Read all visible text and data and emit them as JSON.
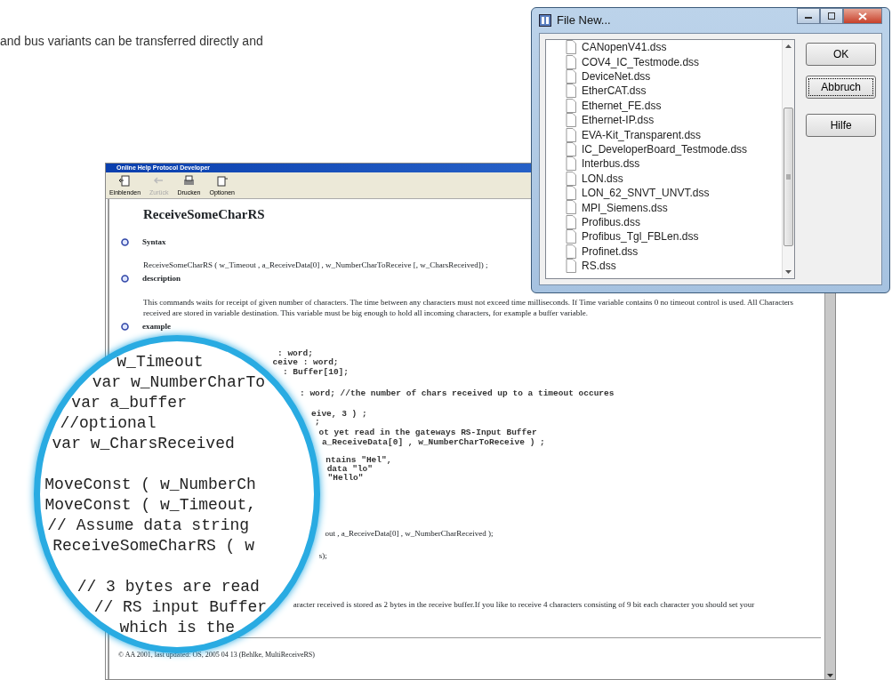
{
  "page_text": "and bus variants can be transferred directly and",
  "help_window": {
    "title": "Online Help Protocol Developer",
    "toolbar": [
      {
        "label": "Einblenden",
        "disabled": false,
        "kind": "show"
      },
      {
        "label": "Zurück",
        "disabled": true,
        "kind": "back"
      },
      {
        "label": "Drucken",
        "disabled": false,
        "kind": "print"
      },
      {
        "label": "Optionen",
        "disabled": false,
        "kind": "options"
      }
    ],
    "heading": "ReceiveSomeCharRS",
    "sections": [
      {
        "title": "Syntax",
        "text": "ReceiveSomeCharRS ( w_Timeout , a_ReceiveData[0] , w_NumberCharToReceive [, w_CharsReceived]) ;"
      },
      {
        "title": "description",
        "text": "This commands waits for receipt of given number of characters. The time between any characters must not exceed time milliseconds. If Time variable contains 0 no timeout control is used. All Characters received are stored in variable destination. This variable must be big enough to hold all incoming characters, for example a buffer variable."
      },
      {
        "title": "example"
      }
    ],
    "fragments": [
      {
        "kind": "code",
        "text": ": word;"
      },
      {
        "kind": "code",
        "text": "ceive : word;"
      },
      {
        "kind": "code",
        "text": ": Buffer[10];"
      },
      {
        "kind": "code",
        "text": ": word;  //the number of chars received up to a timeout occures"
      },
      {
        "kind": "code",
        "text": "eive, 3 ) ;"
      },
      {
        "kind": "code",
        "text": ";"
      },
      {
        "kind": "code",
        "text": "ot yet read in the gateways RS-Input Buffer"
      },
      {
        "kind": "code",
        "text": "a_ReceiveData[0] , w_NumberCharToReceive ) ;"
      },
      {
        "kind": "code",
        "text": "ntains \"Hel\","
      },
      {
        "kind": "code",
        "text": "data \"lo\""
      },
      {
        "kind": "code",
        "text": "\"Hello\""
      },
      {
        "kind": "prose",
        "text": "out , a_ReceiveData[0] , w_NumberCharReceived );"
      },
      {
        "kind": "prose",
        "text": "s);"
      },
      {
        "kind": "prose",
        "text": "aracter received is stored as 2 bytes in the receive buffer.If you like to receive 4 characters consisting of 9 bit each character you should set your"
      }
    ],
    "footer": "© AA 2001, last updated: OS, 2005 04 13 (Behlke, MultiReceiveRS)"
  },
  "magnifier": {
    "blocks": [
      [
        "w_Timeout",
        "var w_NumberCharTo",
        "var a_buffer",
        "//optional",
        "var w_CharsReceived"
      ],
      [
        "MoveConst ( w_NumberCh",
        "MoveConst ( w_Timeout,",
        "// Assume data string",
        "ReceiveSomeCharRS ( w"
      ],
      [
        "// 3 bytes are read",
        "// RS input Buffer",
        "which is the"
      ]
    ]
  },
  "file_dialog": {
    "title": "File New...",
    "files": [
      "CANopenV41.dss",
      "COV4_IC_Testmode.dss",
      "DeviceNet.dss",
      "EtherCAT.dss",
      "Ethernet_FE.dss",
      "Ethernet-IP.dss",
      "EVA-Kit_Transparent.dss",
      "IC_DeveloperBoard_Testmode.dss",
      "Interbus.dss",
      "LON.dss",
      "LON_62_SNVT_UNVT.dss",
      "MPI_Siemens.dss",
      "Profibus.dss",
      "Profibus_Tgl_FBLen.dss",
      "Profinet.dss",
      "RS.dss"
    ],
    "buttons": [
      {
        "label": "OK",
        "focused": false
      },
      {
        "label": "Abbruch",
        "focused": true
      },
      {
        "label": "Hilfe",
        "focused": false
      }
    ]
  }
}
